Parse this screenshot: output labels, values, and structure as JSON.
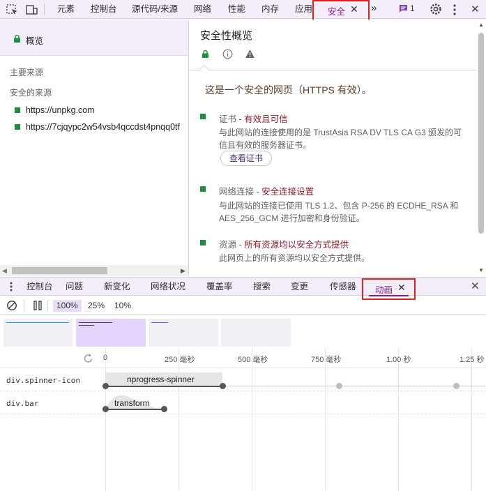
{
  "top_tabs": {
    "elements": "元素",
    "console": "控制台",
    "sources": "源代码/来源",
    "network": "网络",
    "performance": "性能",
    "memory": "内存",
    "application": "应用",
    "security": "安全",
    "issues_count": "1"
  },
  "left_panel": {
    "overview": "概览",
    "main_origin": "主要来源",
    "secure_origins": "安全的来源",
    "origins": [
      "https://unpkg.com",
      "https://7cjqypc2w54vsb4qccdst4pnqq0tf"
    ]
  },
  "overview": {
    "title": "安全性概览",
    "summary": "这是一个安全的网页（HTTPS 有效）。",
    "items": [
      {
        "title": "证书 - ",
        "status": "有效且可信",
        "text": "与此网站的连接使用的是 TrustAsia RSA DV TLS CA G3 颁发的可信且有效的服务器证书。",
        "button": "查看证书"
      },
      {
        "title": "网络连接 - ",
        "status": "安全连接设置",
        "text": "与此网站的连接已使用 TLS 1.2、包含 P-256 的 ECDHE_RSA 和 AES_256_GCM 进行加密和身份验证。"
      },
      {
        "title": "资源 - ",
        "status": "所有资源均以安全方式提供",
        "text": "此网页上的所有资源均以安全方式提供。"
      }
    ]
  },
  "drawer_tabs": {
    "console": "控制台",
    "issues": "问题",
    "whats_new": "新变化",
    "network_conditions": "网络状况",
    "coverage": "覆盖率",
    "search": "搜索",
    "changes": "变更",
    "sensors": "传感器",
    "animations": "动画"
  },
  "animation_toolbar": {
    "speeds": [
      "100%",
      "25%",
      "10%"
    ],
    "selected_speed": "100%"
  },
  "timeline": {
    "ticks": [
      "0",
      "250 毫秒",
      "500 毫秒",
      "750 毫秒",
      "1.00 秒",
      "1.25 秒"
    ],
    "rows": [
      {
        "element": "div.spinner-icon",
        "animation": "nprogress-spinner"
      },
      {
        "element": "div.bar",
        "animation": "transform"
      }
    ]
  },
  "colors": {
    "accent": "#8b1e8f",
    "secure_green": "#1e8e3e",
    "highlight_border": "#e0201b",
    "tab_bar_bg": "#f3eef9"
  }
}
